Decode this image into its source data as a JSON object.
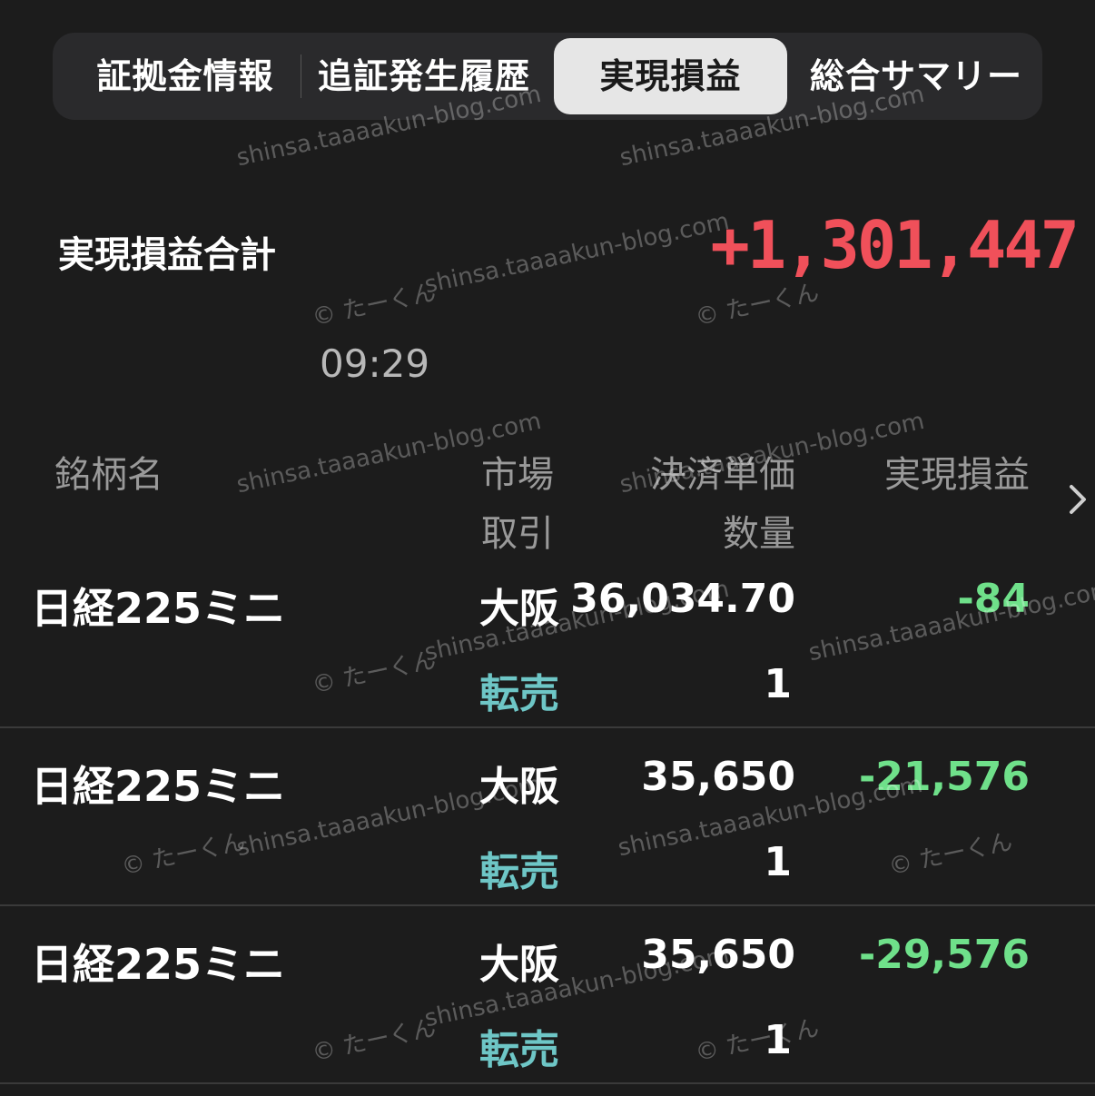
{
  "tabs": [
    {
      "label": "証拠金情報",
      "active": false
    },
    {
      "label": "追証発生履歴",
      "active": false
    },
    {
      "label": "実現損益",
      "active": true
    },
    {
      "label": "総合サマリー",
      "active": false
    }
  ],
  "summary": {
    "label": "実現損益合計",
    "value": "+1,301,447",
    "time": "09:29"
  },
  "columns": {
    "name": "銘柄名",
    "market": "市場",
    "trade": "取引",
    "price": "決済単価",
    "qty": "数量",
    "pnl": "実現損益"
  },
  "rows": [
    {
      "name": "日経225ミニ",
      "market": "大阪",
      "trade": "転売",
      "price": "36,034.70",
      "qty": "1",
      "pnl": "-84"
    },
    {
      "name": "日経225ミニ",
      "market": "大阪",
      "trade": "転売",
      "price": "35,650",
      "qty": "1",
      "pnl": "-21,576"
    },
    {
      "name": "日経225ミニ",
      "market": "大阪",
      "trade": "転売",
      "price": "35,650",
      "qty": "1",
      "pnl": "-29,576"
    }
  ],
  "watermark": {
    "site": "shinsa.taaaakun-blog.com",
    "author": "© たーくん"
  },
  "colors": {
    "background": "#1c1c1c",
    "positive_total": "#f0505a",
    "negative_pnl": "#6fe08a",
    "trade_type": "#6ec6c6",
    "active_tab_bg": "#e6e6e6"
  },
  "icons": {
    "more": "chevron-right-icon"
  }
}
